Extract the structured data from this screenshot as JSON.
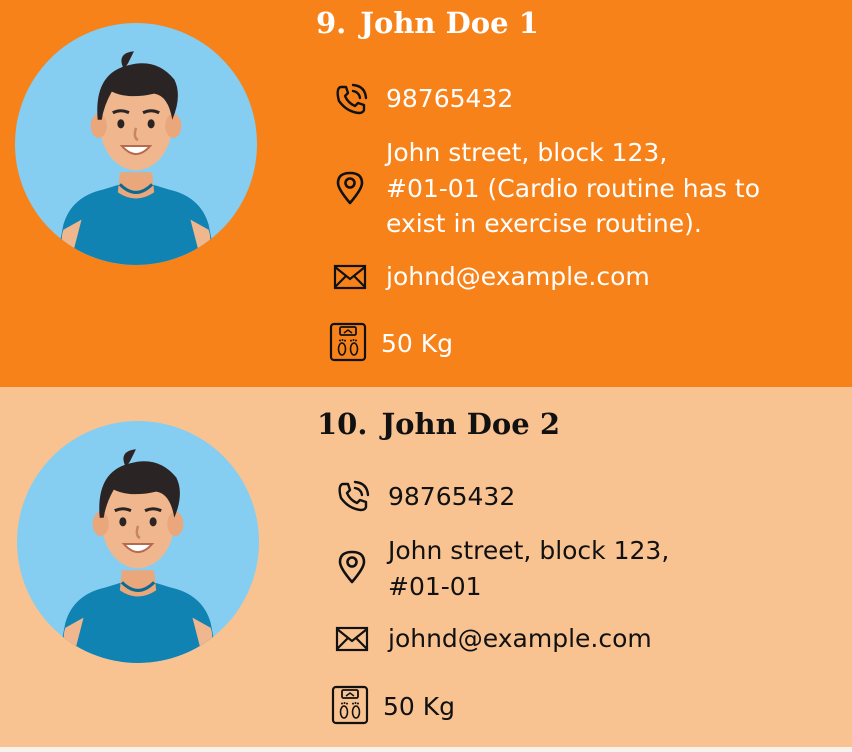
{
  "persons": [
    {
      "index": "9.",
      "name": "John Doe 1",
      "phone": "98765432",
      "address_lines": [
        "John street, block 123,",
        "#01-01 (Cardio routine has to",
        "exist in exercise routine)."
      ],
      "email": "johnd@example.com",
      "weight": "50 Kg",
      "background": "#f8821a",
      "text_color": "#ffffff"
    },
    {
      "index": "10.",
      "name": "John Doe 2",
      "phone": "98765432",
      "address_lines": [
        "John street, block 123,",
        "#01-01"
      ],
      "email": "johnd@example.com",
      "weight": "50 Kg",
      "background": "#f9c391",
      "text_color": "#111111"
    }
  ],
  "icons": {
    "avatar": "person-avatar-icon",
    "phone": "phone-icon",
    "address": "location-pin-icon",
    "email": "envelope-icon",
    "weight": "weighing-scale-icon"
  },
  "colors": {
    "avatar_circle": "#86cdf2",
    "shirt": "#1183b2",
    "skin": "#f0b68d",
    "hair": "#2b2424"
  }
}
